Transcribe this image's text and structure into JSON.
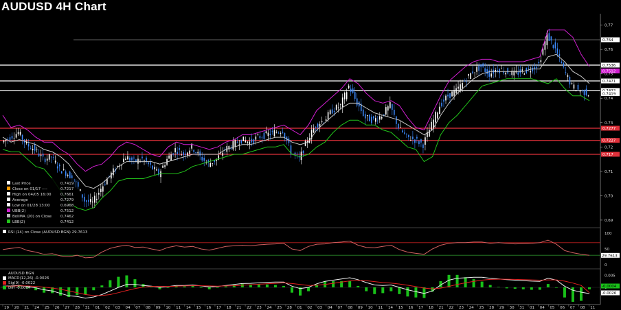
{
  "title": "AUDUSD 4H Chart",
  "colors": {
    "background": "#000000",
    "upper_band": "#d21fd2",
    "lower_band": "#22c41a",
    "sma": "#c8c8c8",
    "candle_up": "#ffffff",
    "candle_down": "#3d8bff",
    "level_white": "#ffffff",
    "level_red": "#e0303a",
    "rsi_line": "#d06060",
    "macd_line": "#f0f0f0",
    "signal_line": "#e02020",
    "diff_bar": "#19c019"
  },
  "price_panel": {
    "y_axis_ticks": [
      "0.77",
      "0.76",
      "0.75",
      "0.74",
      "0.73",
      "0.72",
      "0.71",
      "0.70",
      "0.69"
    ],
    "right_labels": [
      {
        "text": "0.764",
        "bg": "#ffffff",
        "fg": "#000000"
      },
      {
        "text": "0.7536",
        "bg": "#ffffff",
        "fg": "#000000"
      },
      {
        "text": "0.7512",
        "bg": "#d21fd2",
        "fg": "#ffffff"
      },
      {
        "text": "0.7471",
        "bg": "#ffffff",
        "fg": "#000000"
      },
      {
        "text": "0.7432",
        "bg": "#ffffff",
        "fg": "#000000"
      },
      {
        "text": "0.7419",
        "bg": "#ffffff",
        "fg": "#000000"
      },
      {
        "text": "0.7277",
        "bg": "#e0303a",
        "fg": "#ffffff"
      },
      {
        "text": "0.7227",
        "bg": "#e0303a",
        "fg": "#ffffff"
      },
      {
        "text": "0.717",
        "bg": "#e0303a",
        "fg": "#ffffff"
      }
    ],
    "horizontal_levels": [
      {
        "value": 0.764,
        "color": "#808080"
      },
      {
        "value": 0.7536,
        "color": "#ffffff"
      },
      {
        "value": 0.7471,
        "color": "#ffffff"
      },
      {
        "value": 0.7432,
        "color": "#ffffff"
      },
      {
        "value": 0.7277,
        "color": "#e0303a"
      },
      {
        "value": 0.7227,
        "color": "#e0303a"
      },
      {
        "value": 0.717,
        "color": "#e0303a"
      }
    ],
    "legend": [
      {
        "label": "Last Price",
        "value": "0.7419",
        "swatch": "#ffffff"
      },
      {
        "label": "Close on 01/17 ----",
        "value": "0.7217",
        "swatch": "#ff9900"
      },
      {
        "label": "High on 04/05 16:00",
        "value": "0.7661",
        "swatch": "#ffffff"
      },
      {
        "label": "Average",
        "value": "0.7279",
        "swatch": "#ffffff"
      },
      {
        "label": "Low on 01/28 13:00",
        "value": "0.6968",
        "swatch": "#ffffff"
      },
      {
        "label": "UBB(2)",
        "value": "0.7512",
        "swatch": "#d21fd2"
      },
      {
        "label": "BollMA (20)  on Close",
        "value": "0.7462",
        "swatch": "#bbbbbb"
      },
      {
        "label": "LBB(2)",
        "value": "0.7412",
        "swatch": "#22c41a"
      }
    ]
  },
  "rsi_panel": {
    "label": "RSI (14)  on Close (AUDUSD BGN) 29.7613",
    "ticks": [
      "100",
      "50",
      "0"
    ],
    "value_label": "29.7613",
    "overbought": 70,
    "oversold": 30
  },
  "macd_panel": {
    "labels": [
      {
        "text": "AUDUSD BGN",
        "swatch": ""
      },
      {
        "text": "MACD(12,26) -0.0026",
        "swatch": "#ffffff"
      },
      {
        "text": "Sig(9)      -0.0022",
        "swatch": "#e02020"
      },
      {
        "text": "Diff        -0.0004",
        "swatch": "#19c019"
      }
    ],
    "ticks": [
      "0.005",
      "0"
    ],
    "value_labels": [
      {
        "text": "-0.0004",
        "bg": "#19c019",
        "fg": "#000000"
      },
      {
        "text": "-0.0026",
        "bg": "#ffffff",
        "fg": "#000000"
      }
    ]
  },
  "x_axis": {
    "days": [
      "19",
      "20",
      "21",
      "24",
      "25",
      "26",
      "27",
      "28",
      "31",
      "01",
      "02",
      "03",
      "04",
      "07",
      "08",
      "09",
      "10",
      "11",
      "14",
      "15",
      "16",
      "17",
      "18",
      "21",
      "22",
      "23",
      "24",
      "25",
      "28",
      "01",
      "02",
      "03",
      "04",
      "07",
      "08",
      "09",
      "10",
      "11",
      "14",
      "15",
      "16",
      "17",
      "18",
      "21",
      "22",
      "23",
      "24",
      "25",
      "28",
      "29",
      "30",
      "31",
      "01",
      "04",
      "05",
      "06",
      "07",
      "08",
      "11"
    ]
  },
  "chart_data": {
    "type": "line",
    "title": "AUDUSD 4H Chart",
    "ylim": [
      0.688,
      0.773
    ],
    "series": [
      {
        "name": "AUDUSD",
        "values": [
          0.722,
          0.724,
          0.726,
          0.721,
          0.719,
          0.715,
          0.716,
          0.711,
          0.709,
          0.705,
          0.698,
          0.697,
          0.703,
          0.708,
          0.712,
          0.716,
          0.714,
          0.715,
          0.712,
          0.709,
          0.715,
          0.719,
          0.717,
          0.72,
          0.716,
          0.713,
          0.715,
          0.719,
          0.721,
          0.723,
          0.722,
          0.724,
          0.725,
          0.726,
          0.727,
          0.718,
          0.715,
          0.723,
          0.729,
          0.731,
          0.735,
          0.737,
          0.745,
          0.738,
          0.732,
          0.731,
          0.733,
          0.737,
          0.728,
          0.724,
          0.723,
          0.721,
          0.729,
          0.737,
          0.741,
          0.743,
          0.747,
          0.751,
          0.753,
          0.75,
          0.752,
          0.751,
          0.75,
          0.751,
          0.752,
          0.754,
          0.766,
          0.76,
          0.752,
          0.745,
          0.743,
          0.742
        ]
      },
      {
        "name": "UBB(2)",
        "values": [
          0.733,
          0.728,
          0.729,
          0.727,
          0.724,
          0.722,
          0.722,
          0.719,
          0.717,
          0.713,
          0.71,
          0.712,
          0.713,
          0.716,
          0.72,
          0.722,
          0.721,
          0.719,
          0.717,
          0.716,
          0.72,
          0.722,
          0.721,
          0.721,
          0.72,
          0.719,
          0.72,
          0.722,
          0.723,
          0.725,
          0.725,
          0.726,
          0.727,
          0.728,
          0.729,
          0.727,
          0.725,
          0.729,
          0.735,
          0.738,
          0.741,
          0.744,
          0.748,
          0.746,
          0.742,
          0.739,
          0.738,
          0.739,
          0.737,
          0.732,
          0.728,
          0.727,
          0.734,
          0.741,
          0.747,
          0.75,
          0.753,
          0.755,
          0.756,
          0.756,
          0.755,
          0.755,
          0.755,
          0.755,
          0.756,
          0.757,
          0.768,
          0.768,
          0.768,
          0.765,
          0.758,
          0.753
        ]
      },
      {
        "name": "BollMA (20)",
        "values": [
          0.724,
          0.722,
          0.723,
          0.722,
          0.721,
          0.719,
          0.718,
          0.716,
          0.713,
          0.708,
          0.704,
          0.703,
          0.705,
          0.708,
          0.712,
          0.714,
          0.714,
          0.714,
          0.714,
          0.713,
          0.714,
          0.715,
          0.716,
          0.717,
          0.717,
          0.717,
          0.717,
          0.719,
          0.72,
          0.721,
          0.721,
          0.722,
          0.723,
          0.724,
          0.724,
          0.722,
          0.721,
          0.722,
          0.727,
          0.73,
          0.733,
          0.736,
          0.738,
          0.738,
          0.736,
          0.734,
          0.733,
          0.732,
          0.731,
          0.729,
          0.727,
          0.725,
          0.727,
          0.733,
          0.738,
          0.742,
          0.745,
          0.748,
          0.75,
          0.751,
          0.751,
          0.751,
          0.751,
          0.751,
          0.752,
          0.752,
          0.757,
          0.758,
          0.755,
          0.751,
          0.749,
          0.746
        ]
      },
      {
        "name": "LBB(2)",
        "values": [
          0.719,
          0.718,
          0.718,
          0.715,
          0.712,
          0.711,
          0.707,
          0.702,
          0.697,
          0.695,
          0.694,
          0.695,
          0.699,
          0.702,
          0.706,
          0.707,
          0.707,
          0.707,
          0.708,
          0.709,
          0.709,
          0.709,
          0.71,
          0.712,
          0.713,
          0.714,
          0.715,
          0.716,
          0.717,
          0.717,
          0.718,
          0.719,
          0.72,
          0.72,
          0.721,
          0.717,
          0.716,
          0.717,
          0.72,
          0.722,
          0.726,
          0.729,
          0.731,
          0.731,
          0.729,
          0.729,
          0.727,
          0.726,
          0.723,
          0.72,
          0.719,
          0.714,
          0.716,
          0.725,
          0.73,
          0.733,
          0.737,
          0.741,
          0.745,
          0.746,
          0.747,
          0.748,
          0.748,
          0.748,
          0.748,
          0.747,
          0.746,
          0.748,
          0.744,
          0.741,
          0.741,
          0.739
        ]
      }
    ],
    "rsi": [
      48,
      52,
      55,
      45,
      40,
      33,
      35,
      28,
      25,
      30,
      22,
      24,
      40,
      52,
      58,
      62,
      55,
      56,
      50,
      45,
      55,
      60,
      56,
      58,
      50,
      46,
      52,
      58,
      60,
      62,
      60,
      63,
      65,
      66,
      68,
      50,
      45,
      58,
      65,
      66,
      70,
      72,
      75,
      62,
      55,
      54,
      58,
      62,
      48,
      40,
      36,
      33,
      50,
      62,
      68,
      70,
      70,
      72,
      72,
      68,
      70,
      68,
      66,
      67,
      68,
      70,
      78,
      65,
      45,
      38,
      33,
      30
    ],
    "macd": [
      0.0005,
      0.0006,
      0.0008,
      0.0004,
      -0.0002,
      -0.001,
      -0.0015,
      -0.0025,
      -0.0035,
      -0.0038,
      -0.0045,
      -0.004,
      -0.003,
      -0.0015,
      0.0,
      0.0012,
      0.0012,
      0.0008,
      0.0005,
      0.0,
      0.0003,
      0.0008,
      0.0008,
      0.001,
      0.0006,
      0.0002,
      0.0004,
      0.0008,
      0.0012,
      0.0016,
      0.0017,
      0.0019,
      0.0021,
      0.0022,
      0.0022,
      0.0005,
      -0.0005,
      0.0,
      0.0015,
      0.0025,
      0.003,
      0.0035,
      0.004,
      0.0032,
      0.002,
      0.001,
      0.0008,
      0.001,
      0.0,
      -0.001,
      -0.0018,
      -0.0025,
      -0.0015,
      0.001,
      0.003,
      0.0038,
      0.004,
      0.0042,
      0.0042,
      0.0038,
      0.0035,
      0.0032,
      0.003,
      0.0028,
      0.0026,
      0.0025,
      0.0038,
      0.003,
      0.0005,
      -0.0012,
      -0.002,
      -0.0026
    ],
    "signal": [
      0.0004,
      0.0005,
      0.0006,
      0.0006,
      0.0004,
      0.0001,
      -0.0003,
      -0.0008,
      -0.0015,
      -0.0022,
      -0.003,
      -0.0034,
      -0.0034,
      -0.003,
      -0.0022,
      -0.0013,
      -0.0005,
      0.0001,
      0.0004,
      0.0004,
      0.0004,
      0.0005,
      0.0006,
      0.0007,
      0.0007,
      0.0006,
      0.0005,
      0.0006,
      0.0007,
      0.0009,
      0.0011,
      0.0013,
      0.0015,
      0.0017,
      0.0019,
      0.0016,
      0.0012,
      0.0008,
      0.0009,
      0.0012,
      0.0017,
      0.0022,
      0.0027,
      0.0029,
      0.0028,
      0.0024,
      0.002,
      0.0018,
      0.0014,
      0.0009,
      0.0003,
      -0.0003,
      -0.0006,
      -0.0003,
      0.0004,
      0.0012,
      0.0019,
      0.0025,
      0.003,
      0.0033,
      0.0034,
      0.0034,
      0.0033,
      0.0032,
      0.0031,
      0.003,
      0.0031,
      0.0031,
      0.0026,
      0.0018,
      0.0008,
      -0.0022
    ]
  }
}
